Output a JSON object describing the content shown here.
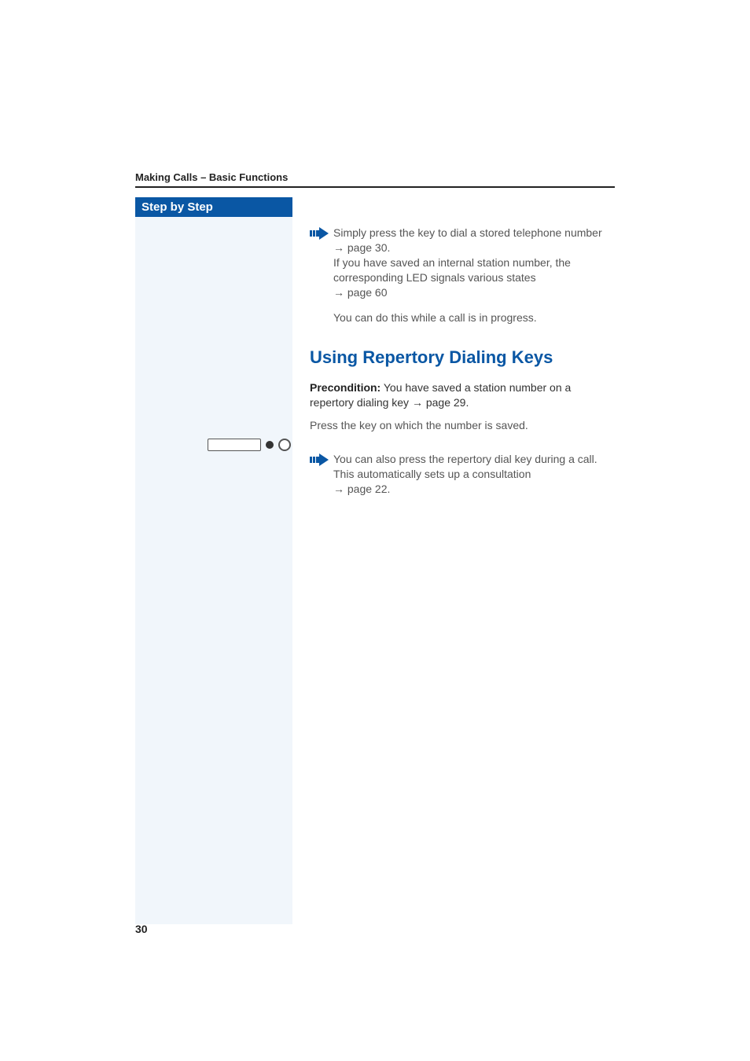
{
  "chapter": "Making Calls – Basic Functions",
  "sidebar": {
    "title": "Step by Step"
  },
  "note1": {
    "line1": "Simply press the key to dial a stored telephone number ",
    "ref1": "→ page 30.",
    "line2": "If you have saved an internal station number, the corresponding LED signals various states ",
    "ref2": "→ page 60",
    "after": "You can do this while a call is in progress."
  },
  "heading": "Using Repertory Dialing Keys",
  "precond": {
    "label": "Precondition:",
    "text": " You have saved a station number on a repertory dialing key ",
    "ref": "→ page 29."
  },
  "instruction": "Press the key on which the number is saved.",
  "note2": {
    "line1": "You can also press the repertory dial key during a call. This automatically sets up a consultation ",
    "ref": "→ page 22."
  },
  "pageNumber": "30"
}
